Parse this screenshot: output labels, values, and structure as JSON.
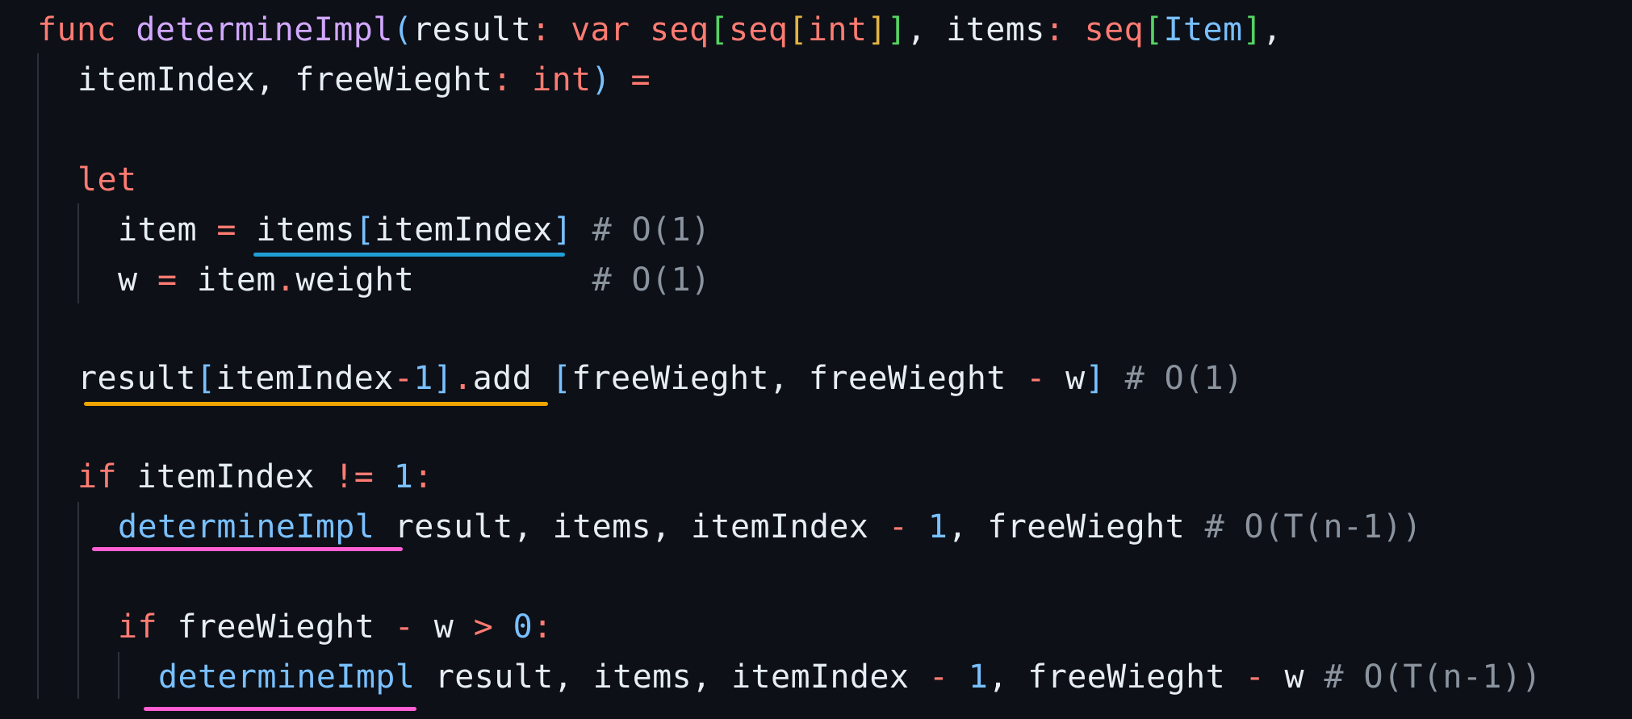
{
  "colors": {
    "background": "#0d1017",
    "text": "#e6edf3",
    "keyword": "#ff7b72",
    "function": "#d2a8ff",
    "function_call": "#79c0ff",
    "number": "#79c0ff",
    "comment": "#8b949e",
    "bracket_1": "#56d364",
    "bracket_2": "#e3b341",
    "bracket_3": "#79c0ff",
    "underline_blue": "#1f9fd6",
    "underline_orange": "#f0a500",
    "underline_pink": "#ff5fd2",
    "indent_guide": "#2b313a"
  },
  "lines": [
    {
      "id": "line-1",
      "tokens": [
        {
          "t": "func",
          "c": "keyword"
        },
        {
          "t": " ",
          "c": "text"
        },
        {
          "t": "determineImpl",
          "c": "function"
        },
        {
          "t": "(",
          "c": "bracket_3"
        },
        {
          "t": "result",
          "c": "text"
        },
        {
          "t": ": ",
          "c": "keyword"
        },
        {
          "t": "var",
          "c": "keyword"
        },
        {
          "t": " ",
          "c": "text"
        },
        {
          "t": "seq",
          "c": "keyword"
        },
        {
          "t": "[",
          "c": "bracket_1"
        },
        {
          "t": "seq",
          "c": "keyword"
        },
        {
          "t": "[",
          "c": "bracket_2"
        },
        {
          "t": "int",
          "c": "keyword"
        },
        {
          "t": "]",
          "c": "bracket_2"
        },
        {
          "t": "]",
          "c": "bracket_1"
        },
        {
          "t": ", items",
          "c": "text"
        },
        {
          "t": ": ",
          "c": "keyword"
        },
        {
          "t": "seq",
          "c": "keyword"
        },
        {
          "t": "[",
          "c": "bracket_1"
        },
        {
          "t": "Item",
          "c": "function_call"
        },
        {
          "t": "]",
          "c": "bracket_1"
        },
        {
          "t": ",",
          "c": "text"
        }
      ]
    },
    {
      "id": "line-2",
      "tokens": [
        {
          "t": "itemIndex, freeWieght",
          "c": "text"
        },
        {
          "t": ": ",
          "c": "keyword"
        },
        {
          "t": "int",
          "c": "keyword"
        },
        {
          "t": ")",
          "c": "bracket_3"
        },
        {
          "t": " ",
          "c": "text"
        },
        {
          "t": "=",
          "c": "keyword"
        }
      ]
    },
    {
      "id": "line-3",
      "tokens": [
        {
          "t": "let",
          "c": "keyword"
        }
      ]
    },
    {
      "id": "line-4",
      "tokens": [
        {
          "t": "item ",
          "c": "text"
        },
        {
          "t": "=",
          "c": "keyword"
        },
        {
          "t": " items",
          "c": "text"
        },
        {
          "t": "[",
          "c": "bracket_3"
        },
        {
          "t": "itemIndex",
          "c": "text"
        },
        {
          "t": "]",
          "c": "bracket_3"
        },
        {
          "t": " # O(1)",
          "c": "comment"
        }
      ]
    },
    {
      "id": "line-5",
      "tokens": [
        {
          "t": "w ",
          "c": "text"
        },
        {
          "t": "=",
          "c": "keyword"
        },
        {
          "t": " item",
          "c": "text"
        },
        {
          "t": ".",
          "c": "keyword"
        },
        {
          "t": "weight         ",
          "c": "text"
        },
        {
          "t": "# O(1)",
          "c": "comment"
        }
      ]
    },
    {
      "id": "line-6",
      "tokens": [
        {
          "t": "result",
          "c": "text"
        },
        {
          "t": "[",
          "c": "bracket_3"
        },
        {
          "t": "itemIndex",
          "c": "text"
        },
        {
          "t": "-",
          "c": "keyword"
        },
        {
          "t": "1",
          "c": "number"
        },
        {
          "t": "]",
          "c": "bracket_3"
        },
        {
          "t": ".",
          "c": "keyword"
        },
        {
          "t": "add ",
          "c": "text"
        },
        {
          "t": "[",
          "c": "bracket_3"
        },
        {
          "t": "freeWieght, freeWieght ",
          "c": "text"
        },
        {
          "t": "-",
          "c": "keyword"
        },
        {
          "t": " w",
          "c": "text"
        },
        {
          "t": "]",
          "c": "bracket_3"
        },
        {
          "t": " # O(1)",
          "c": "comment"
        }
      ]
    },
    {
      "id": "line-7",
      "tokens": [
        {
          "t": "if",
          "c": "keyword"
        },
        {
          "t": " itemIndex ",
          "c": "text"
        },
        {
          "t": "!=",
          "c": "keyword"
        },
        {
          "t": " ",
          "c": "text"
        },
        {
          "t": "1",
          "c": "number"
        },
        {
          "t": ":",
          "c": "keyword"
        }
      ]
    },
    {
      "id": "line-8",
      "tokens": [
        {
          "t": "determineImpl",
          "c": "function_call"
        },
        {
          "t": " result, items, itemIndex ",
          "c": "text"
        },
        {
          "t": "-",
          "c": "keyword"
        },
        {
          "t": " ",
          "c": "text"
        },
        {
          "t": "1",
          "c": "number"
        },
        {
          "t": ", freeWieght ",
          "c": "text"
        },
        {
          "t": "# O(T(n-1))",
          "c": "comment"
        }
      ]
    },
    {
      "id": "line-9",
      "tokens": [
        {
          "t": "if",
          "c": "keyword"
        },
        {
          "t": " freeWieght ",
          "c": "text"
        },
        {
          "t": "-",
          "c": "keyword"
        },
        {
          "t": " w ",
          "c": "text"
        },
        {
          "t": ">",
          "c": "keyword"
        },
        {
          "t": " ",
          "c": "text"
        },
        {
          "t": "0",
          "c": "number"
        },
        {
          "t": ":",
          "c": "keyword"
        }
      ]
    },
    {
      "id": "line-10",
      "tokens": [
        {
          "t": "determineImpl",
          "c": "function_call"
        },
        {
          "t": " result, items, itemIndex ",
          "c": "text"
        },
        {
          "t": "-",
          "c": "keyword"
        },
        {
          "t": " ",
          "c": "text"
        },
        {
          "t": "1",
          "c": "number"
        },
        {
          "t": ", freeWieght ",
          "c": "text"
        },
        {
          "t": "-",
          "c": "keyword"
        },
        {
          "t": " w ",
          "c": "text"
        },
        {
          "t": "# O(T(n-1))",
          "c": "comment"
        }
      ]
    }
  ]
}
